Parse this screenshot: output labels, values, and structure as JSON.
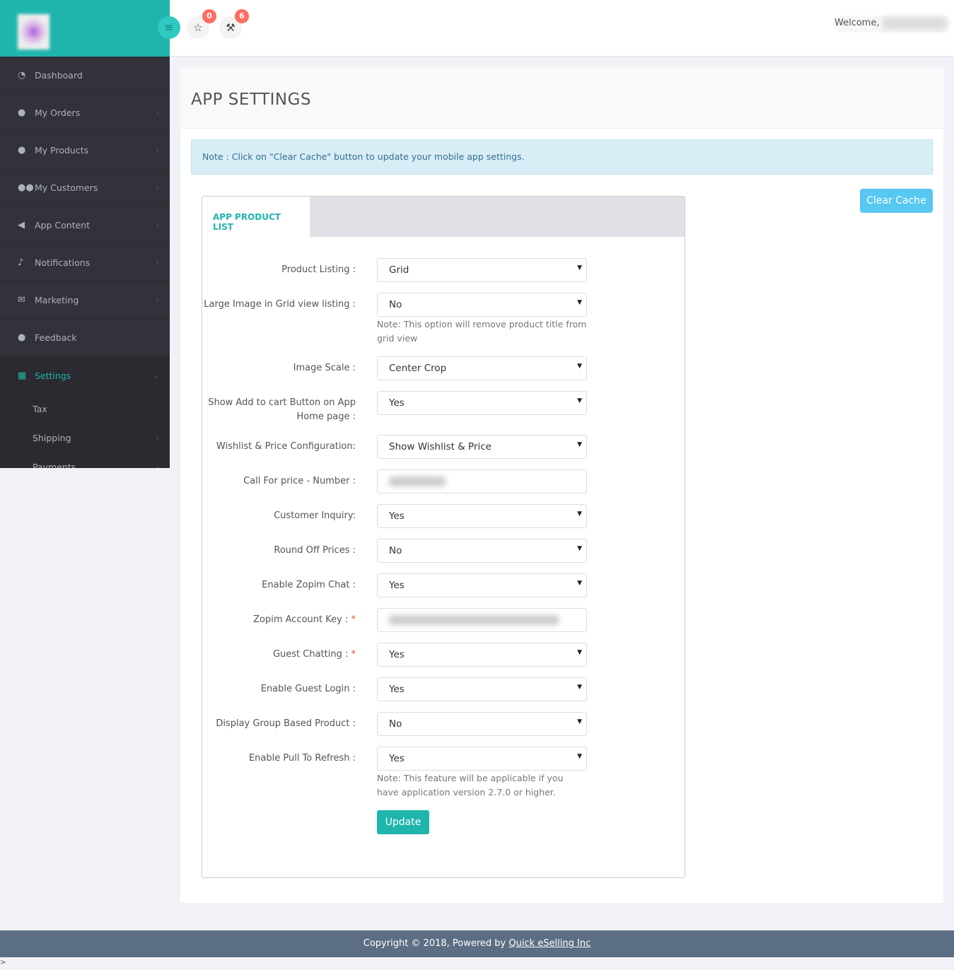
{
  "header": {
    "menu_icon": "bars-icon",
    "star_badge": "0",
    "gavel_badge": "6",
    "welcome": "Welcome,"
  },
  "sidebar": {
    "items": [
      {
        "label": "Dashboard",
        "icon": "dashboard-icon",
        "glyph": "◔",
        "chev": false
      },
      {
        "label": "My Orders",
        "icon": "user-icon",
        "glyph": "●",
        "chev": true
      },
      {
        "label": "My Products",
        "icon": "user-icon",
        "glyph": "●",
        "chev": true
      },
      {
        "label": "My Customers",
        "icon": "users-icon",
        "glyph": "●●",
        "chev": true
      },
      {
        "label": "App Content",
        "icon": "bullhorn-icon",
        "glyph": "◀",
        "chev": true
      },
      {
        "label": "Notifications",
        "icon": "bell-icon",
        "glyph": "♪",
        "chev": true
      },
      {
        "label": "Marketing",
        "icon": "envelope-icon",
        "glyph": "✉",
        "chev": true
      },
      {
        "label": "Feedback",
        "icon": "user-icon",
        "glyph": "●",
        "chev": false
      }
    ],
    "settings": {
      "label": "Settings",
      "icon": "grid-icon",
      "glyph": "▦"
    },
    "sub_items": [
      {
        "label": "Tax",
        "chev": false
      },
      {
        "label": "Shipping",
        "chev": true
      },
      {
        "label": "Payments",
        "chev": true
      }
    ]
  },
  "page": {
    "title": "APP SETTINGS",
    "note": "Note : Click on \"Clear Cache\" button to update your mobile app settings.",
    "clear_cache": "Clear Cache",
    "tab": "APP PRODUCT LIST",
    "update": "Update"
  },
  "form": [
    {
      "label": "Product Listing :",
      "type": "select",
      "value": "Grid"
    },
    {
      "label": "Large Image in Grid view listing :",
      "type": "select",
      "value": "No",
      "hint": "Note: This option will remove product title from grid view"
    },
    {
      "label": "Image Scale :",
      "type": "select",
      "value": "Center Crop"
    },
    {
      "label": "Show Add to cart Button on App Home page :",
      "type": "select",
      "value": "Yes"
    },
    {
      "label": "Wishlist & Price Configuration:",
      "type": "select",
      "value": "Show Wishlist & Price"
    },
    {
      "label": "Call For price - Number :",
      "type": "input"
    },
    {
      "label": "Customer Inquiry:",
      "type": "select",
      "value": "Yes"
    },
    {
      "label": "Round Off Prices :",
      "type": "select",
      "value": "No"
    },
    {
      "label": "Enable Zopim Chat :",
      "type": "select",
      "value": "Yes"
    },
    {
      "label": "Zopim Account Key :",
      "type": "input",
      "required": "*"
    },
    {
      "label": "Guest Chatting :",
      "type": "select",
      "value": "Yes",
      "required": "*"
    },
    {
      "label": "Enable Guest Login :",
      "type": "select",
      "value": "Yes"
    },
    {
      "label": "Display Group Based Product :",
      "type": "select",
      "value": "No"
    },
    {
      "label": "Enable Pull To Refresh :",
      "type": "select",
      "value": "Yes",
      "hint": "Note: This feature will be applicable if you have application version 2.7.0 or higher."
    }
  ],
  "footer": {
    "text": "Copyright © 2018, Powered by",
    "link": "Quick eSelling Inc",
    "corner": ">"
  }
}
